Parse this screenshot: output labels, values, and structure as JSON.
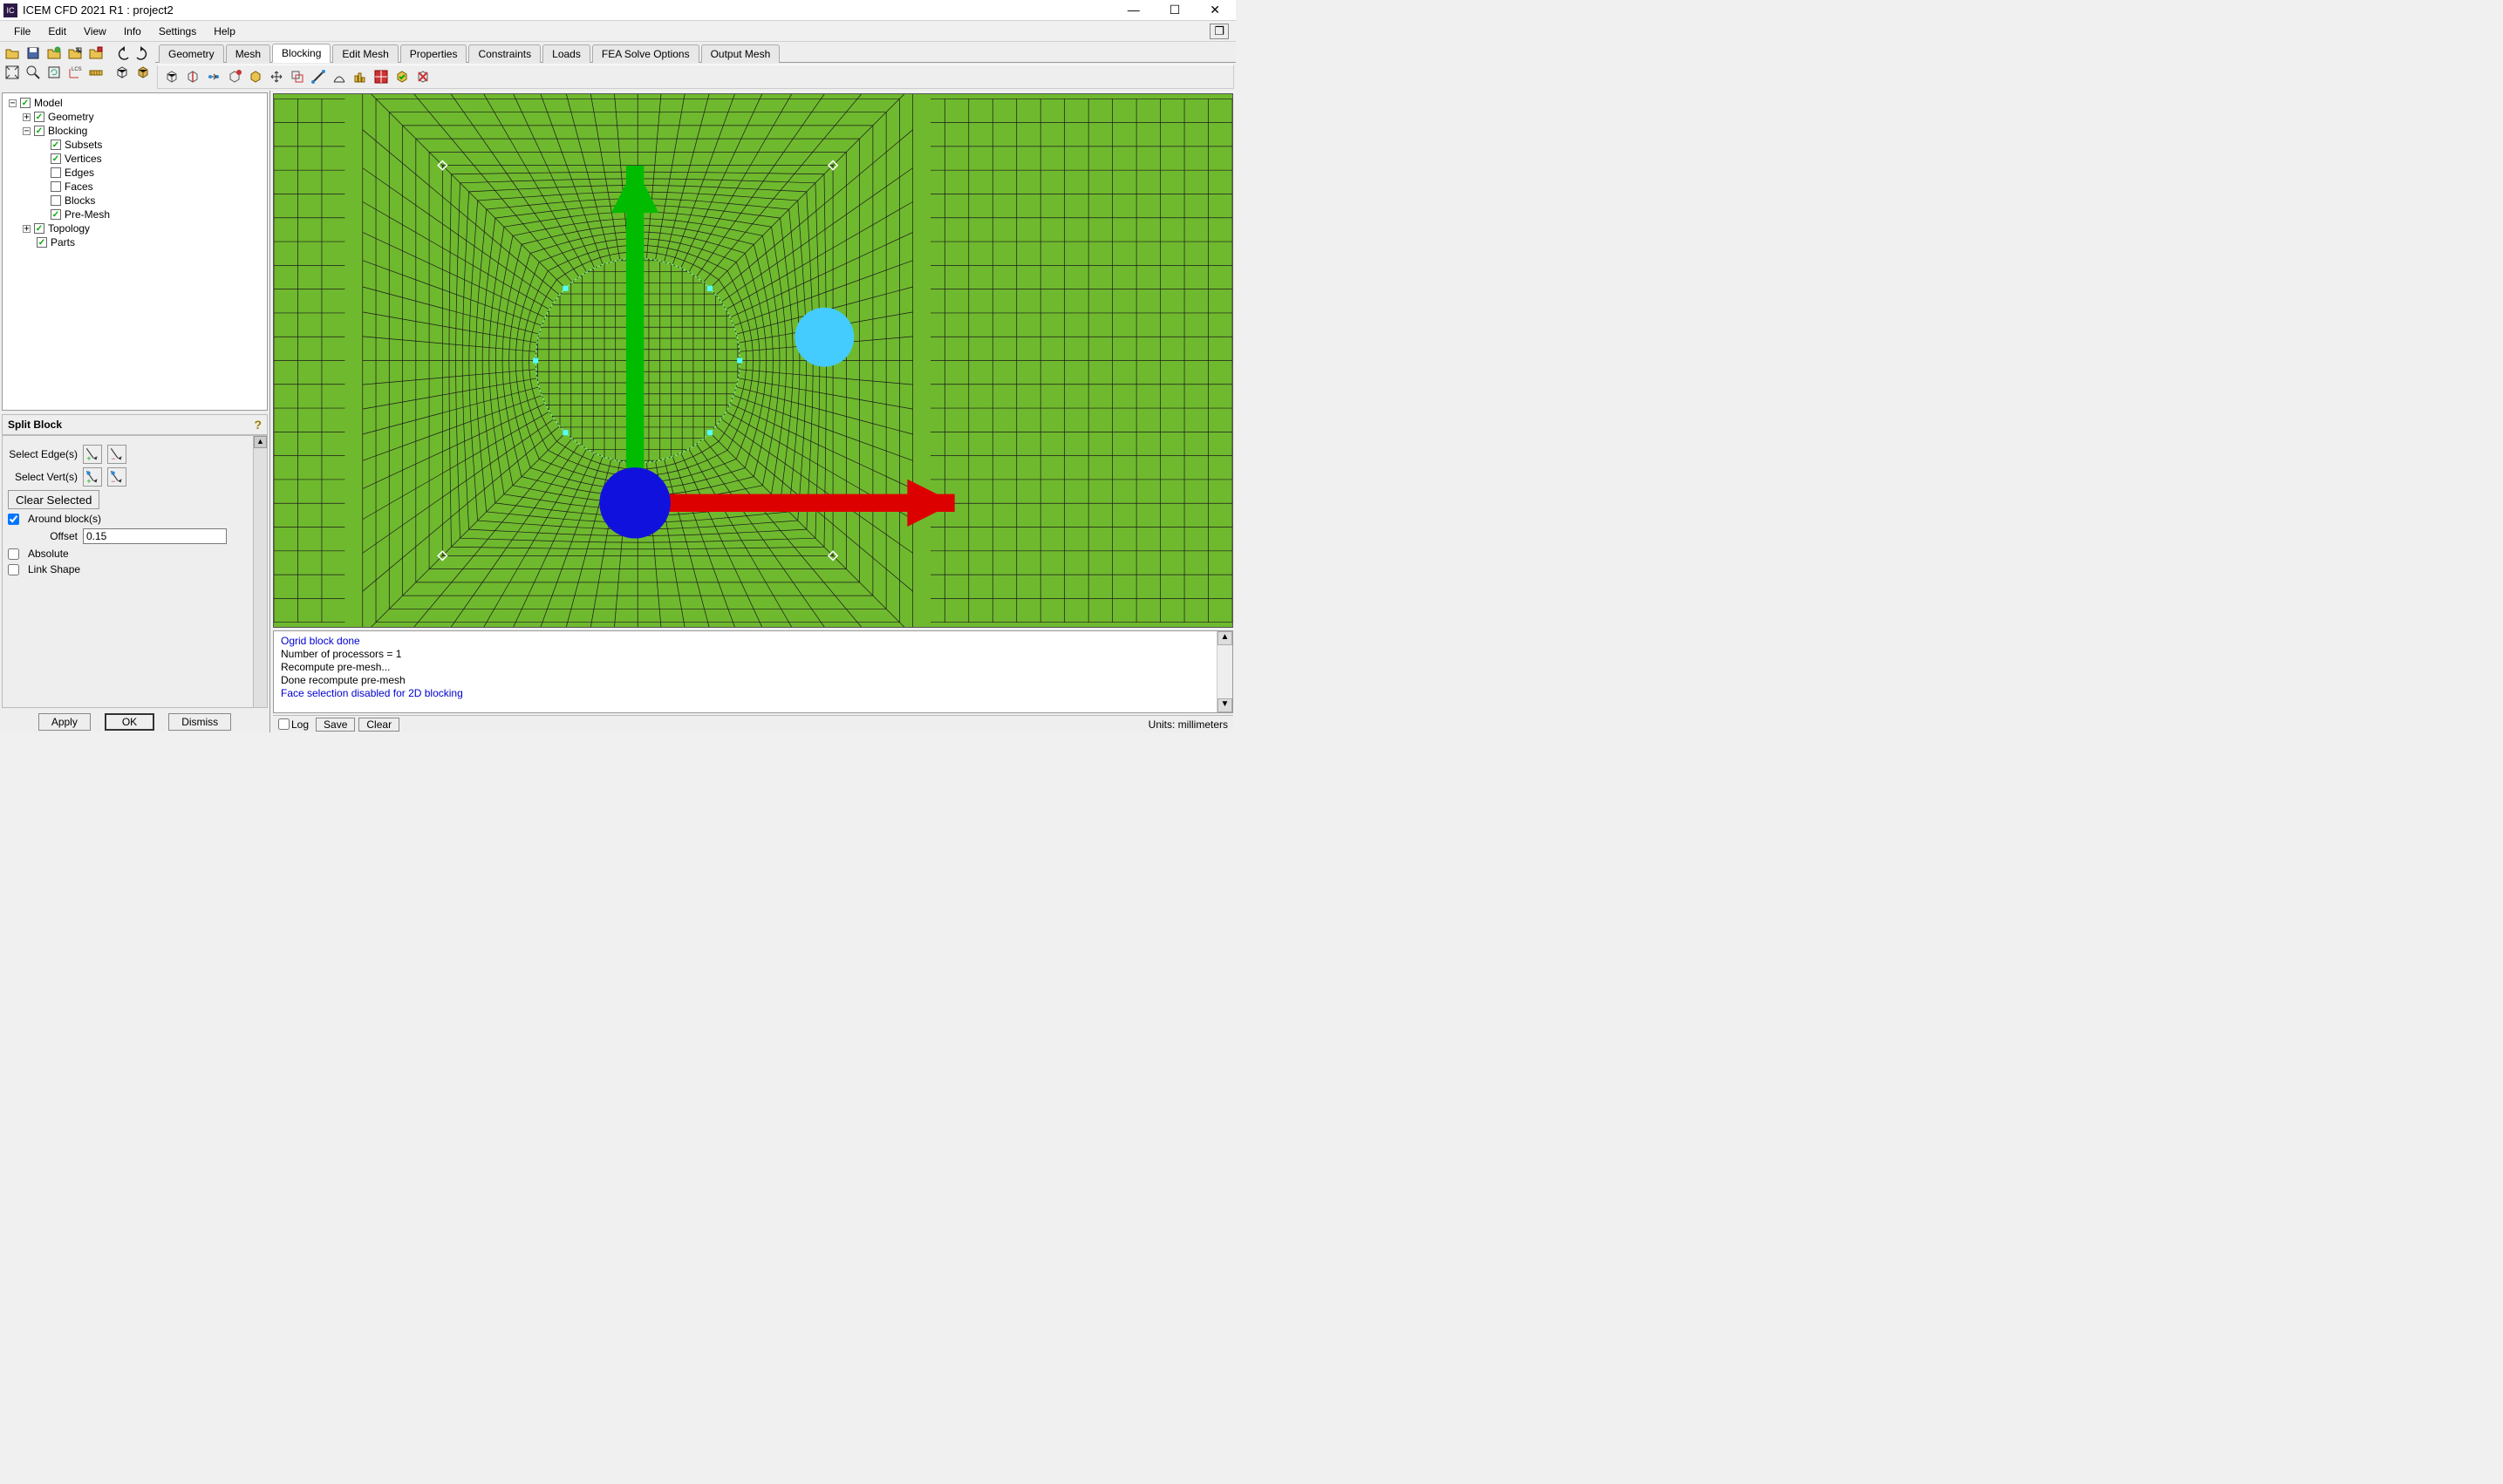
{
  "title": "ICEM CFD 2021 R1 : project2",
  "menu": [
    "File",
    "Edit",
    "View",
    "Info",
    "Settings",
    "Help"
  ],
  "tabs": [
    "Geometry",
    "Mesh",
    "Blocking",
    "Edit Mesh",
    "Properties",
    "Constraints",
    "Loads",
    "FEA Solve Options",
    "Output Mesh"
  ],
  "activeTab": "Blocking",
  "tree": {
    "root": "Model",
    "items": [
      {
        "level": 0,
        "toggle": "−",
        "checked": true,
        "label": "Model"
      },
      {
        "level": 1,
        "toggle": "+",
        "checked": true,
        "label": "Geometry"
      },
      {
        "level": 1,
        "toggle": "−",
        "checked": true,
        "label": "Blocking"
      },
      {
        "level": 2,
        "toggle": "",
        "checked": true,
        "label": "Subsets"
      },
      {
        "level": 2,
        "toggle": "",
        "checked": true,
        "label": "Vertices"
      },
      {
        "level": 2,
        "toggle": "",
        "checked": false,
        "label": "Edges"
      },
      {
        "level": 2,
        "toggle": "",
        "checked": false,
        "label": "Faces"
      },
      {
        "level": 2,
        "toggle": "",
        "checked": false,
        "label": "Blocks"
      },
      {
        "level": 2,
        "toggle": "",
        "checked": true,
        "label": "Pre-Mesh"
      },
      {
        "level": 1,
        "toggle": "+",
        "checked": true,
        "label": "Topology"
      },
      {
        "level": 1,
        "toggle": "",
        "checked": true,
        "label": "Parts"
      }
    ]
  },
  "panel": {
    "title": "Split Block",
    "selectEdge": "Select Edge(s)",
    "selectVert": "Select Vert(s)",
    "clearSelected": "Clear Selected",
    "aroundBlock": "Around block(s)",
    "aroundBlockChecked": true,
    "offsetLabel": "Offset",
    "offsetValue": "0.15",
    "absolute": "Absolute",
    "absoluteChecked": false,
    "linkShape": "Link Shape",
    "linkShapeChecked": false
  },
  "buttons": {
    "apply": "Apply",
    "ok": "OK",
    "dismiss": "Dismiss"
  },
  "messages": [
    {
      "text": "Ogrid block done",
      "cls": "blue"
    },
    {
      "text": "Number of processors = 1",
      "cls": ""
    },
    {
      "text": "Recompute pre-mesh...",
      "cls": ""
    },
    {
      "text": "Done recompute pre-mesh",
      "cls": ""
    },
    {
      "text": "Face selection disabled for 2D blocking",
      "cls": "blue"
    }
  ],
  "bottom": {
    "log": "Log",
    "save": "Save",
    "clear": "Clear",
    "units": "Units: millimeters"
  }
}
